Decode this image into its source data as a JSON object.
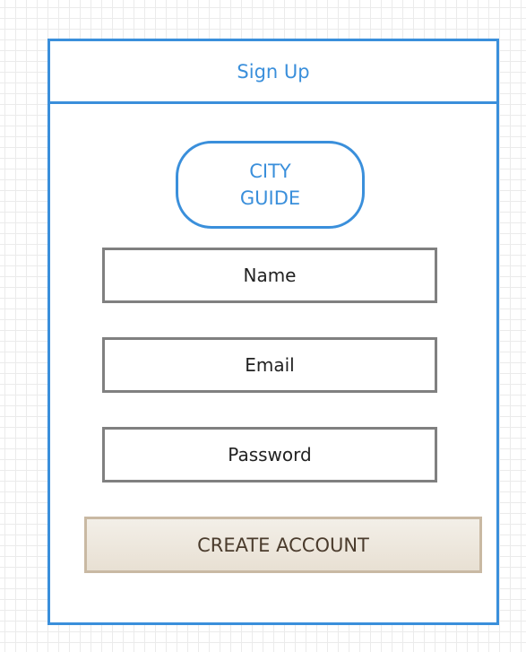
{
  "header": {
    "title": "Sign Up"
  },
  "logo": {
    "text": "CITY\nGUIDE"
  },
  "form": {
    "fields": [
      {
        "label": "Name"
      },
      {
        "label": "Email"
      },
      {
        "label": "Password"
      }
    ],
    "submit_label": "CREATE ACCOUNT"
  },
  "colors": {
    "accent": "#3a8fdb",
    "field_border": "#808080",
    "button_border": "#c9b9a3",
    "button_fill": "#ece5da"
  }
}
